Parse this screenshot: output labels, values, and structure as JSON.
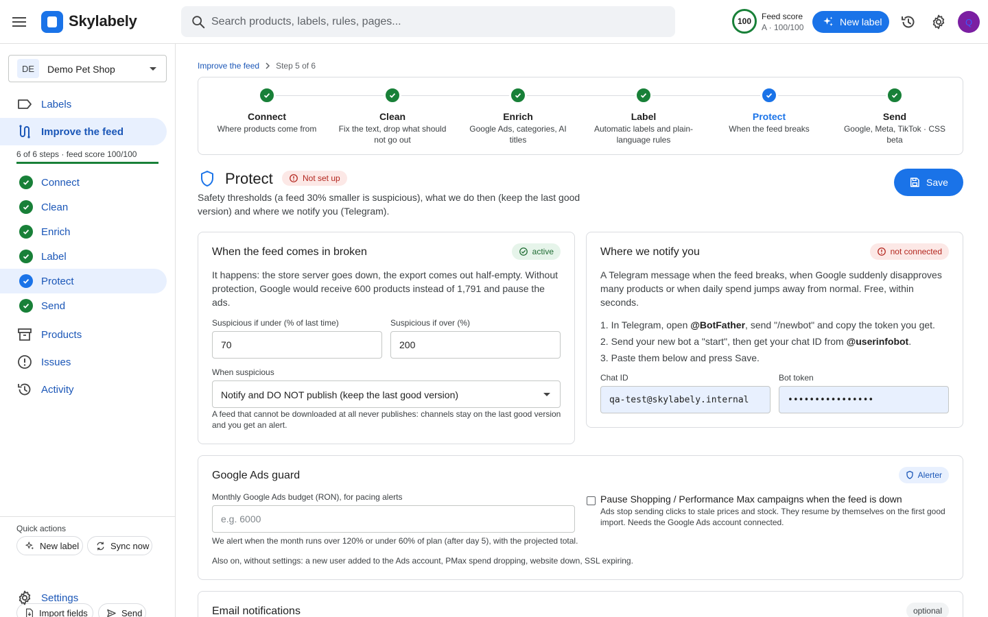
{
  "app": {
    "name": "Skylabely"
  },
  "search": {
    "placeholder": "Search products, labels, rules, pages..."
  },
  "header": {
    "score_ring": "100",
    "score_label": "Feed score",
    "score_value": "A · 100/100",
    "new_label": "New label",
    "avatar_initial": "Q"
  },
  "sidebar": {
    "shop": {
      "badge": "DE",
      "name": "Demo Pet Shop"
    },
    "nav": {
      "labels": "Labels",
      "improve": "Improve the feed",
      "products": "Products",
      "issues": "Issues",
      "activity": "Activity",
      "settings": "Settings"
    },
    "progress_text": "6 of 6 steps · feed score 100/100",
    "progress_fraction": 1.0,
    "steps": [
      "Connect",
      "Clean",
      "Enrich",
      "Label",
      "Protect",
      "Send"
    ],
    "quick_actions_title": "Quick actions",
    "quick_actions": [
      "New label",
      "Sync now",
      "Import fields",
      "Send"
    ]
  },
  "breadcrumb": {
    "parent": "Improve the feed",
    "current": "Step 5 of 6"
  },
  "stepper": [
    {
      "title": "Connect",
      "desc": "Where products come from"
    },
    {
      "title": "Clean",
      "desc": "Fix the text, drop what should not go out"
    },
    {
      "title": "Enrich",
      "desc": "Google Ads, categories, AI titles"
    },
    {
      "title": "Label",
      "desc": "Automatic labels and plain-language rules"
    },
    {
      "title": "Protect",
      "desc": "When the feed breaks"
    },
    {
      "title": "Send",
      "desc": "Google, Meta, TikTok · CSS beta"
    }
  ],
  "page": {
    "title": "Protect",
    "status": "Not set up",
    "description": "Safety thresholds (a feed 30% smaller is suspicious), what we do then (keep the last good version) and where we notify you (Telegram).",
    "save": "Save"
  },
  "broken_card": {
    "title": "When the feed comes in broken",
    "status": "active",
    "text": "It happens: the store server goes down, the export comes out half-empty. Without protection, Google would receive 600 products instead of 1,791 and pause the ads.",
    "under_label": "Suspicious if under (% of last time)",
    "under_value": "70",
    "over_label": "Suspicious if over (%)",
    "over_value": "200",
    "when_label": "When suspicious",
    "when_value": "Notify and DO NOT publish (keep the last good version)",
    "hint": "A feed that cannot be downloaded at all never publishes: channels stay on the last good version and you get an alert."
  },
  "notify_card": {
    "title": "Where we notify you",
    "status": "not connected",
    "text": "A Telegram message when the feed breaks, when Google suddenly disapproves many products or when daily spend jumps away from normal. Free, within seconds.",
    "step1_pre": "1. In Telegram, open ",
    "step1_bold": "@BotFather",
    "step1_post": ", send \"/newbot\" and copy the token you get.",
    "step2_pre": "2. Send your new bot a \"start\", then get your chat ID from ",
    "step2_bold": "@userinfobot",
    "step2_post": ".",
    "step3": "3. Paste them below and press Save.",
    "chat_label": "Chat ID",
    "chat_value": "qa-test@skylabely.internal",
    "token_label": "Bot token",
    "token_value": "••••••••••••••••"
  },
  "ads_card": {
    "title": "Google Ads guard",
    "status": "Alerter",
    "budget_label": "Monthly Google Ads budget (RON), for pacing alerts",
    "budget_placeholder": "e.g. 6000",
    "budget_hint": "We alert when the month runs over 120% or under 60% of plan (after day 5), with the projected total.",
    "pause_label": "Pause Shopping / Performance Max campaigns when the feed is down",
    "pause_desc": "Ads stop sending clicks to stale prices and stock. They resume by themselves on the first good import. Needs the Google Ads account connected.",
    "also_text": "Also on, without settings: a new user added to the Ads account, PMax spend dropping, website down, SSL expiring."
  },
  "email_card": {
    "title": "Email notifications",
    "status": "optional"
  },
  "colors": {
    "primary": "#1a73e8",
    "success": "#188038",
    "error": "#b3261e"
  }
}
